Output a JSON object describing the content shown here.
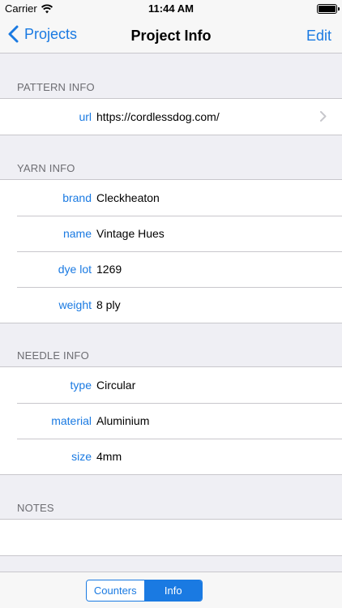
{
  "status_bar": {
    "carrier": "Carrier",
    "time": "11:44 AM"
  },
  "nav": {
    "back_label": "Projects",
    "title": "Project Info",
    "edit_label": "Edit"
  },
  "sections": {
    "pattern": {
      "header": "PATTERN INFO",
      "rows": [
        {
          "label": "url",
          "value": "https://cordlessdog.com/"
        }
      ]
    },
    "yarn": {
      "header": "YARN INFO",
      "rows": [
        {
          "label": "brand",
          "value": "Cleckheaton"
        },
        {
          "label": "name",
          "value": "Vintage Hues"
        },
        {
          "label": "dye lot",
          "value": "1269"
        },
        {
          "label": "weight",
          "value": "8 ply"
        }
      ]
    },
    "needle": {
      "header": "NEEDLE INFO",
      "rows": [
        {
          "label": "type",
          "value": "Circular"
        },
        {
          "label": "material",
          "value": "Aluminium"
        },
        {
          "label": "size",
          "value": "4mm"
        }
      ]
    },
    "notes": {
      "header": "NOTES",
      "value": ""
    }
  },
  "segments": {
    "counters": "Counters",
    "info": "Info",
    "selected": "Info"
  },
  "colors": {
    "accent": "#1a7ae2",
    "background": "#efeff4",
    "separator": "#c8c7cc"
  },
  "icons": {
    "back": "chevron-left-icon",
    "disclosure": "chevron-right-icon",
    "wifi": "wifi-icon",
    "battery": "battery-icon"
  }
}
